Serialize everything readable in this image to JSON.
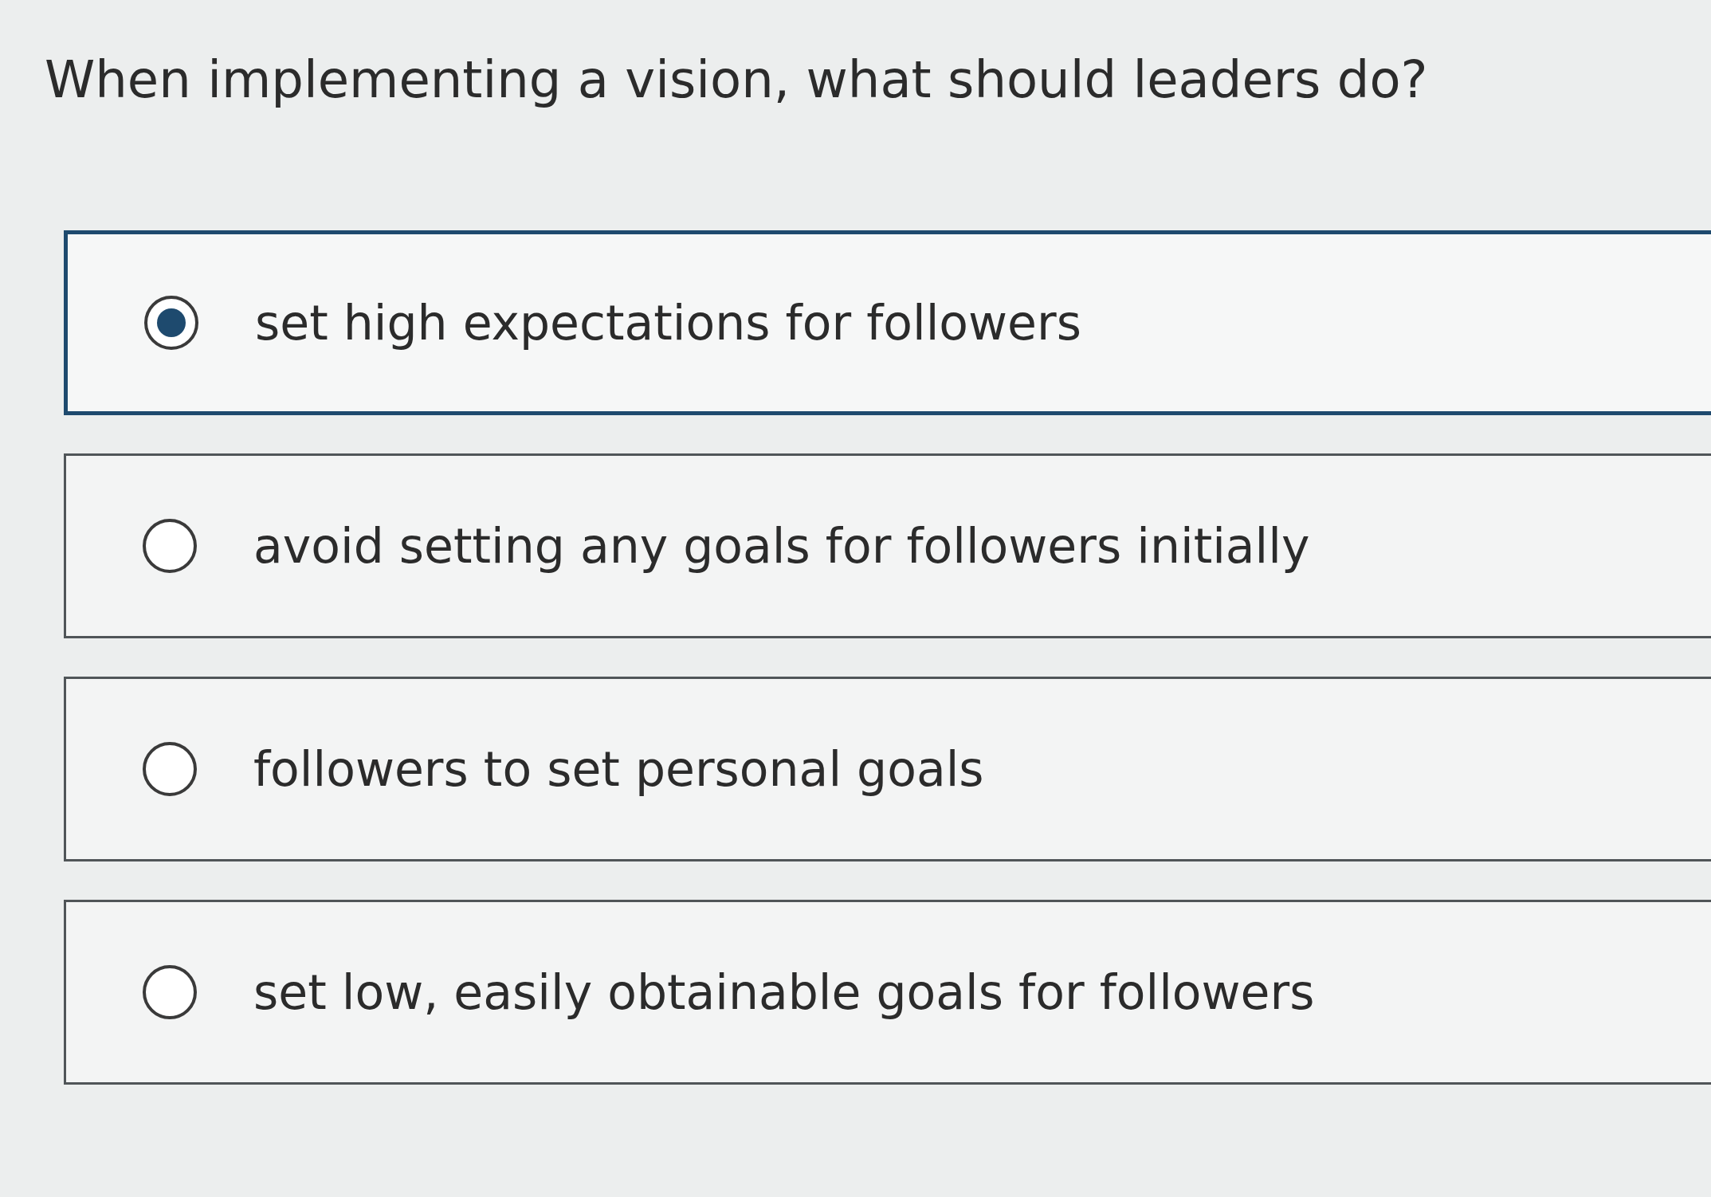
{
  "question": "When implementing a vision, what should leaders do?",
  "options": [
    {
      "label": "set high expectations for followers",
      "selected": true
    },
    {
      "label": "avoid setting any goals for followers initially",
      "selected": false
    },
    {
      "label": "followers to set personal goals",
      "selected": false
    },
    {
      "label": "set low, easily obtainable goals for followers",
      "selected": false
    }
  ]
}
